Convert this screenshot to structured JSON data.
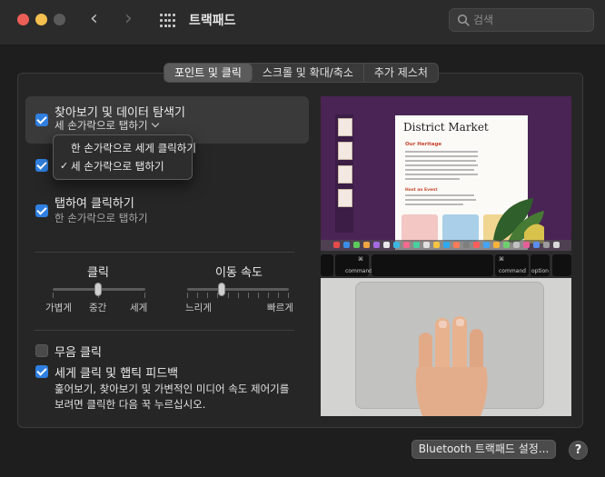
{
  "window": {
    "title": "트랙패드",
    "search_placeholder": "검색"
  },
  "tabs": [
    {
      "label": "포인트 및 클릭",
      "active": true
    },
    {
      "label": "스크롤 및 확대/축소",
      "active": false
    },
    {
      "label": "추가 제스처",
      "active": false
    }
  ],
  "options": {
    "lookup": {
      "label": "찾아보기 및 데이터 탐색기",
      "value": "세 손가락으로 탭하기",
      "checked": true,
      "menu": [
        {
          "label": "한 손가락으로 세게 클릭하기",
          "selected": false
        },
        {
          "label": "세 손가락으로 탭하기",
          "selected": true
        }
      ]
    },
    "secondary_click": {
      "checked": true
    },
    "tap_to_click": {
      "label": "탭하여 클릭하기",
      "sublabel": "한 손가락으로 탭하기",
      "checked": true
    }
  },
  "sliders": {
    "click": {
      "title": "클릭",
      "labels": [
        "가볍게",
        "중간",
        "세게"
      ],
      "value": 0.5
    },
    "tracking_speed": {
      "title": "이동 속도",
      "min_label": "느리게",
      "max_label": "빠르게",
      "value": 0.3
    }
  },
  "checkboxes": {
    "silent_click": {
      "label": "무음 클릭",
      "checked": false
    },
    "force_click": {
      "label": "세게 클릭 및 햅틱 피드백",
      "checked": true
    }
  },
  "force_click_description": "훑어보기, 찾아보기 및 가변적인 미디어 속도 제어기를 보려면 클릭한 다음 꾹 누르십시오.",
  "preview": {
    "document_title": "District Market",
    "section_heading": "Our Heritage",
    "caption": "Host an Event",
    "key_labels": {
      "command": "command",
      "option": "option"
    }
  },
  "footer": {
    "bluetooth_button": "Bluetooth 트랙패드 설정...",
    "help_button": "?"
  },
  "colors": {
    "accent": "#2f7fe0",
    "window_bg": "#1e1e1e",
    "panel_bg": "#262626"
  }
}
